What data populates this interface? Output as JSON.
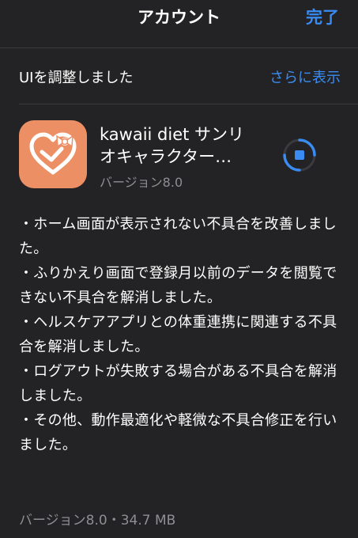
{
  "navbar": {
    "title": "アカウント",
    "done_label": "完了"
  },
  "section": {
    "title": "UIを調整しました",
    "more_label": "さらに表示"
  },
  "app": {
    "name": "kawaii diet サンリオキャラクター…",
    "version": "バージョン8.0",
    "icon": "heart-bow-icon",
    "icon_color": "#ec8f65",
    "download_state": "downloading-stop-icon"
  },
  "release_notes": [
    "・ホーム画面が表示されない不具合を改善しました。",
    "・ふりかえり画面で登録月以前のデータを閲覧できない不具合を解消しました。",
    "・ヘルスケアアプリとの体重連携に関連する不具合を解消しました。",
    "・ログアウトが失敗する場合がある不具合を解消しました。",
    "・その他、動作最適化や軽微な不具合修正を行いました。"
  ],
  "footer": {
    "version_size": "バージョン8.0・34.7 MB"
  },
  "colors": {
    "background": "#232325",
    "accent": "#3a8cf2",
    "secondary_text": "#8e8e93"
  }
}
